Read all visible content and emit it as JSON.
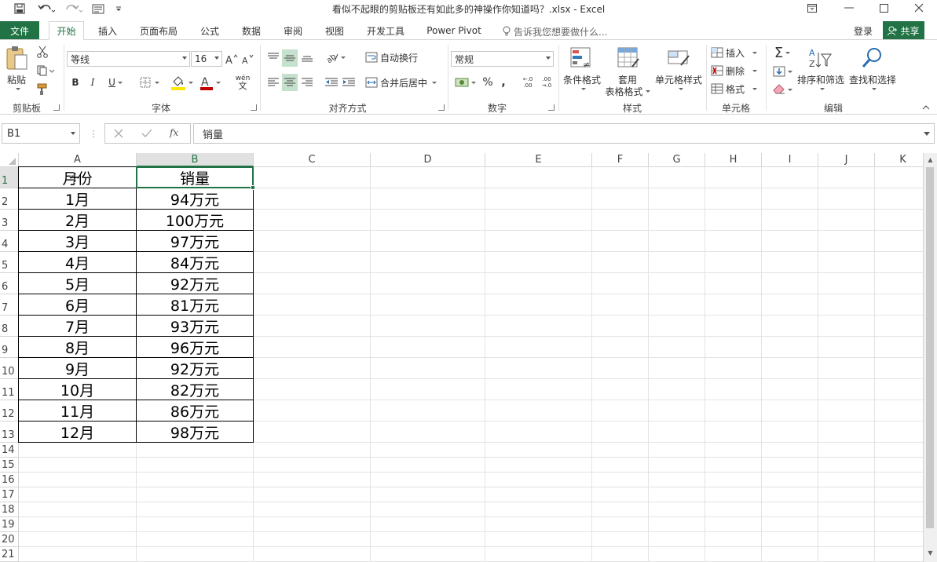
{
  "window": {
    "title": "看似不起眼的剪贴板还有如此多的神操作你知道吗？.xlsx - Excel"
  },
  "ribbon_tabs": [
    {
      "label": "文件"
    },
    {
      "label": "开始"
    },
    {
      "label": "插入"
    },
    {
      "label": "页面布局"
    },
    {
      "label": "公式"
    },
    {
      "label": "数据"
    },
    {
      "label": "审阅"
    },
    {
      "label": "视图"
    },
    {
      "label": "开发工具"
    },
    {
      "label": "Power Pivot"
    }
  ],
  "tell_me": "告诉我您想要做什么...",
  "account": {
    "login": "登录",
    "share": "共享"
  },
  "clipboard": {
    "paste": "粘贴",
    "group": "剪贴板"
  },
  "font": {
    "name": "等线",
    "size": "16",
    "group": "字体",
    "phonetic_top": "wén",
    "phonetic_bottom": "文"
  },
  "alignment": {
    "wrap": "自动换行",
    "merge": "合并后居中",
    "group": "对齐方式"
  },
  "number": {
    "format": "常规",
    "percent": "%",
    "comma": ",",
    "group": "数字",
    "inc_decimal": "←.0 .00",
    "dec_decimal": ".00 →.0"
  },
  "styles": {
    "conditional": "条件格式",
    "table_line1": "套用",
    "table_line2": "表格格式",
    "cell_styles": "单元格样式",
    "group": "样式"
  },
  "cells": {
    "insert": "插入",
    "delete": "删除",
    "format": "格式",
    "group": "单元格"
  },
  "editing": {
    "sort": "排序和筛选",
    "find": "查找和选择",
    "group": "编辑"
  },
  "formula_bar": {
    "name_box": "B1",
    "value": "销量"
  },
  "columns": [
    "A",
    "B",
    "C",
    "D",
    "E",
    "F",
    "G",
    "H",
    "I",
    "J",
    "K"
  ],
  "rows": [
    "1",
    "2",
    "3",
    "4",
    "5",
    "6",
    "7",
    "8",
    "9",
    "10",
    "11",
    "12",
    "13",
    "14",
    "15",
    "16",
    "17",
    "18",
    "19",
    "20",
    "21"
  ],
  "table": {
    "header": {
      "a": "月份",
      "b": "销量"
    },
    "data": [
      {
        "a": "1月",
        "b": "94万元"
      },
      {
        "a": "2月",
        "b": "100万元"
      },
      {
        "a": "3月",
        "b": "97万元"
      },
      {
        "a": "4月",
        "b": "84万元"
      },
      {
        "a": "5月",
        "b": "92万元"
      },
      {
        "a": "6月",
        "b": "81万元"
      },
      {
        "a": "7月",
        "b": "93万元"
      },
      {
        "a": "8月",
        "b": "96万元"
      },
      {
        "a": "9月",
        "b": "92万元"
      },
      {
        "a": "10月",
        "b": "82万元"
      },
      {
        "a": "11月",
        "b": "86万元"
      },
      {
        "a": "12月",
        "b": "98万元"
      }
    ]
  },
  "selected_cell": "B1",
  "colors": {
    "accent": "#217346",
    "grid": "#e3e3e3",
    "header_sel": "#e1e1e1"
  }
}
